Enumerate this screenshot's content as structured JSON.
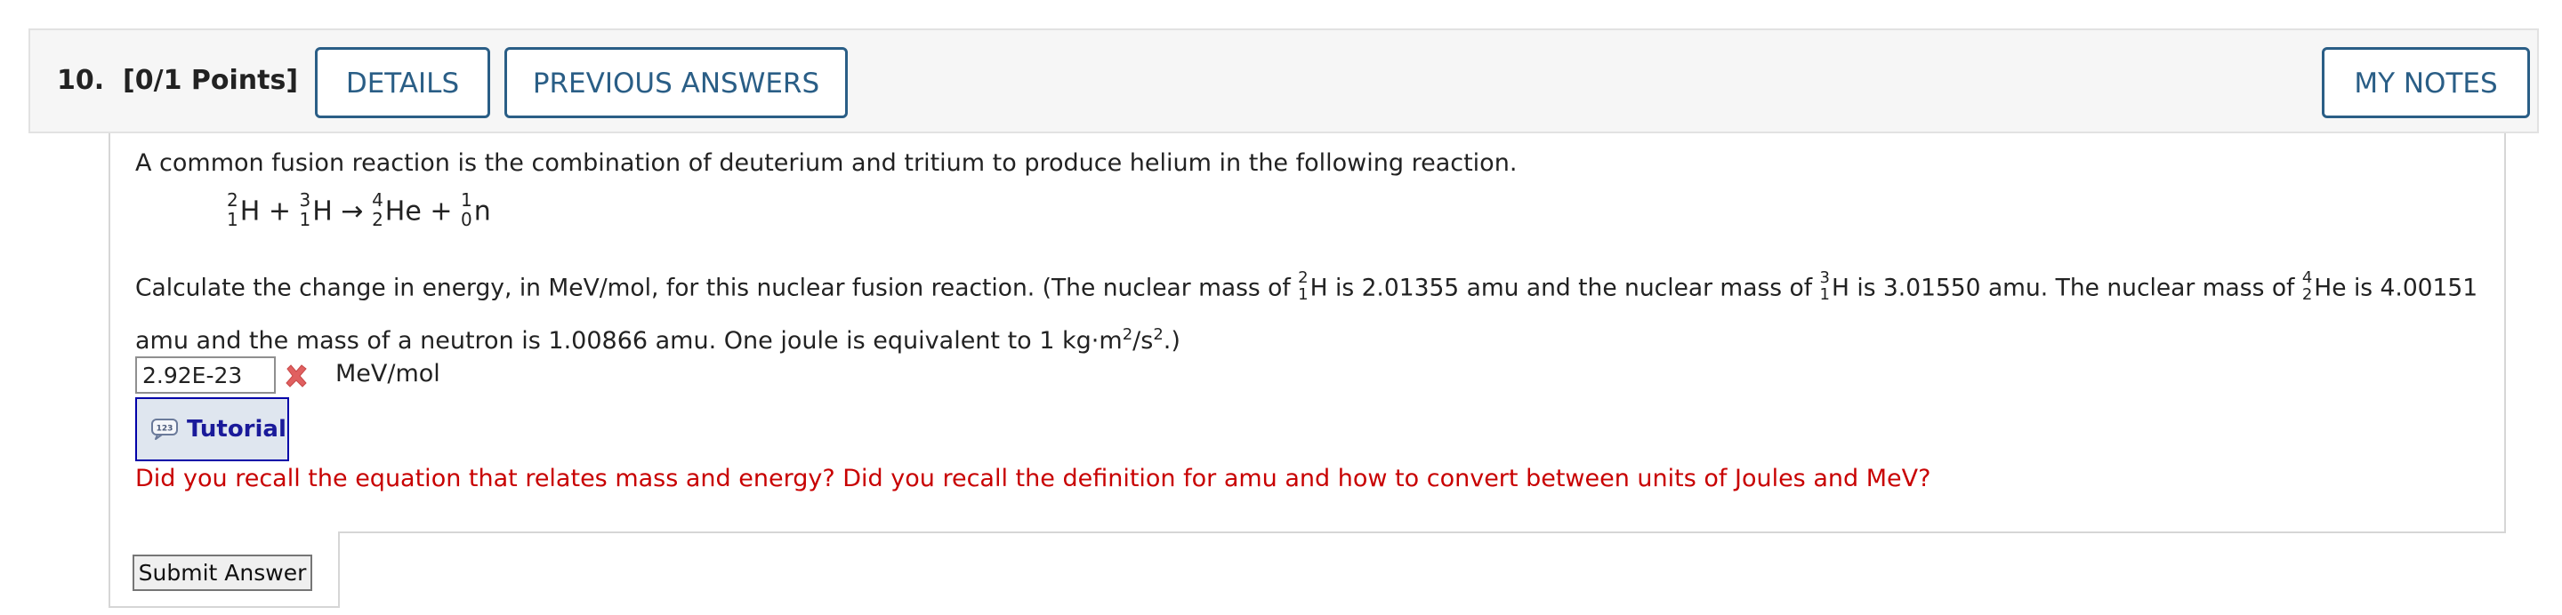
{
  "question": {
    "number": "10.",
    "points": "[0/1 Points]",
    "details_label": "DETAILS",
    "previous_answers_label": "PREVIOUS ANSWERS",
    "my_notes_label": "MY NOTES"
  },
  "body": {
    "intro": "A common fusion reaction is the combination of deuterium and tritium to produce helium in the following reaction.",
    "equation": {
      "nuclides": [
        {
          "mass": "2",
          "atomic": "1",
          "symbol": "H"
        },
        {
          "mass": "3",
          "atomic": "1",
          "symbol": "H"
        },
        {
          "mass": "4",
          "atomic": "2",
          "symbol": "He"
        },
        {
          "mass": "1",
          "atomic": "0",
          "symbol": "n"
        }
      ],
      "plus": "+",
      "arrow": "→"
    },
    "prompt_part1": "Calculate the change in energy, in MeV/mol, for this nuclear fusion reaction. (The nuclear mass of",
    "prompt_part2": "is 2.01355 amu and the nuclear mass of",
    "prompt_part3": "is 3.01550 amu. The nuclear mass of",
    "prompt_part4": "is 4.00151",
    "prompt_line2_a": "amu and the mass of a neutron is 1.00866 amu. One joule is equivalent to 1 kg·m",
    "prompt_line2_sup1": "2",
    "prompt_line2_b": "/s",
    "prompt_line2_sup2": "2",
    "prompt_line2_c": ".)"
  },
  "answer": {
    "value": "2.92E-23",
    "status": "incorrect",
    "status_icon": "x-icon",
    "unit": "MeV/mol"
  },
  "tutorial": {
    "label": "Tutorial",
    "icon": "calculator-speech-icon"
  },
  "feedback": "Did you recall the equation that relates mass and energy? Did you recall the definition for amu and how to convert between units of Joules and MeV?",
  "submit_label": "Submit Answer",
  "colors": {
    "accent": "#2a5e86",
    "error": "#c80000",
    "error_icon": "#e06060",
    "tutorial_bg": "#dfe6ef",
    "tutorial_border": "#0000a8"
  }
}
